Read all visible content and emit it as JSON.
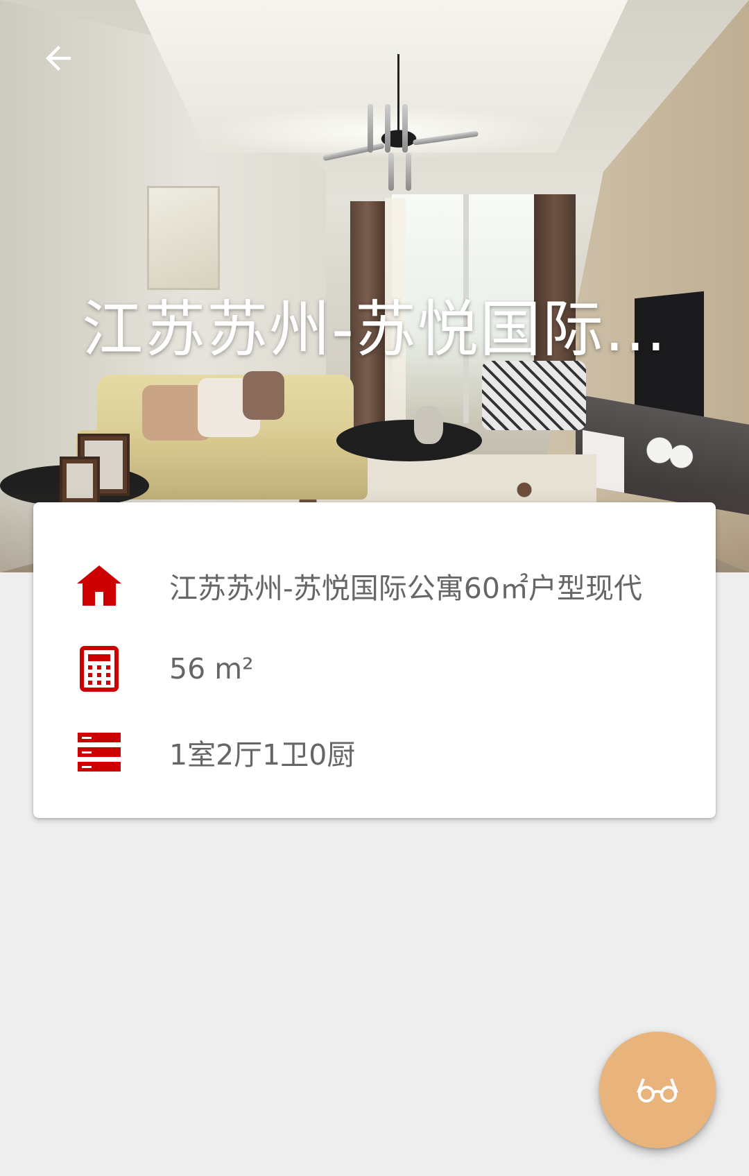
{
  "header": {
    "title": "江苏苏州-苏悦国际..."
  },
  "details": {
    "name": "江苏苏州-苏悦国际公寓60㎡户型现代",
    "area": "56   m²",
    "layout": "1室2厅1卫0厨"
  },
  "icons": {
    "back": "arrow-left-icon",
    "name": "home-icon",
    "area": "calculator-icon",
    "layout": "list-icon",
    "fab": "glasses-icon"
  },
  "colors": {
    "accent_red": "#cc0000",
    "fab_orange": "#e8b47c",
    "text_gray": "#666666",
    "background": "#eeeeee"
  }
}
